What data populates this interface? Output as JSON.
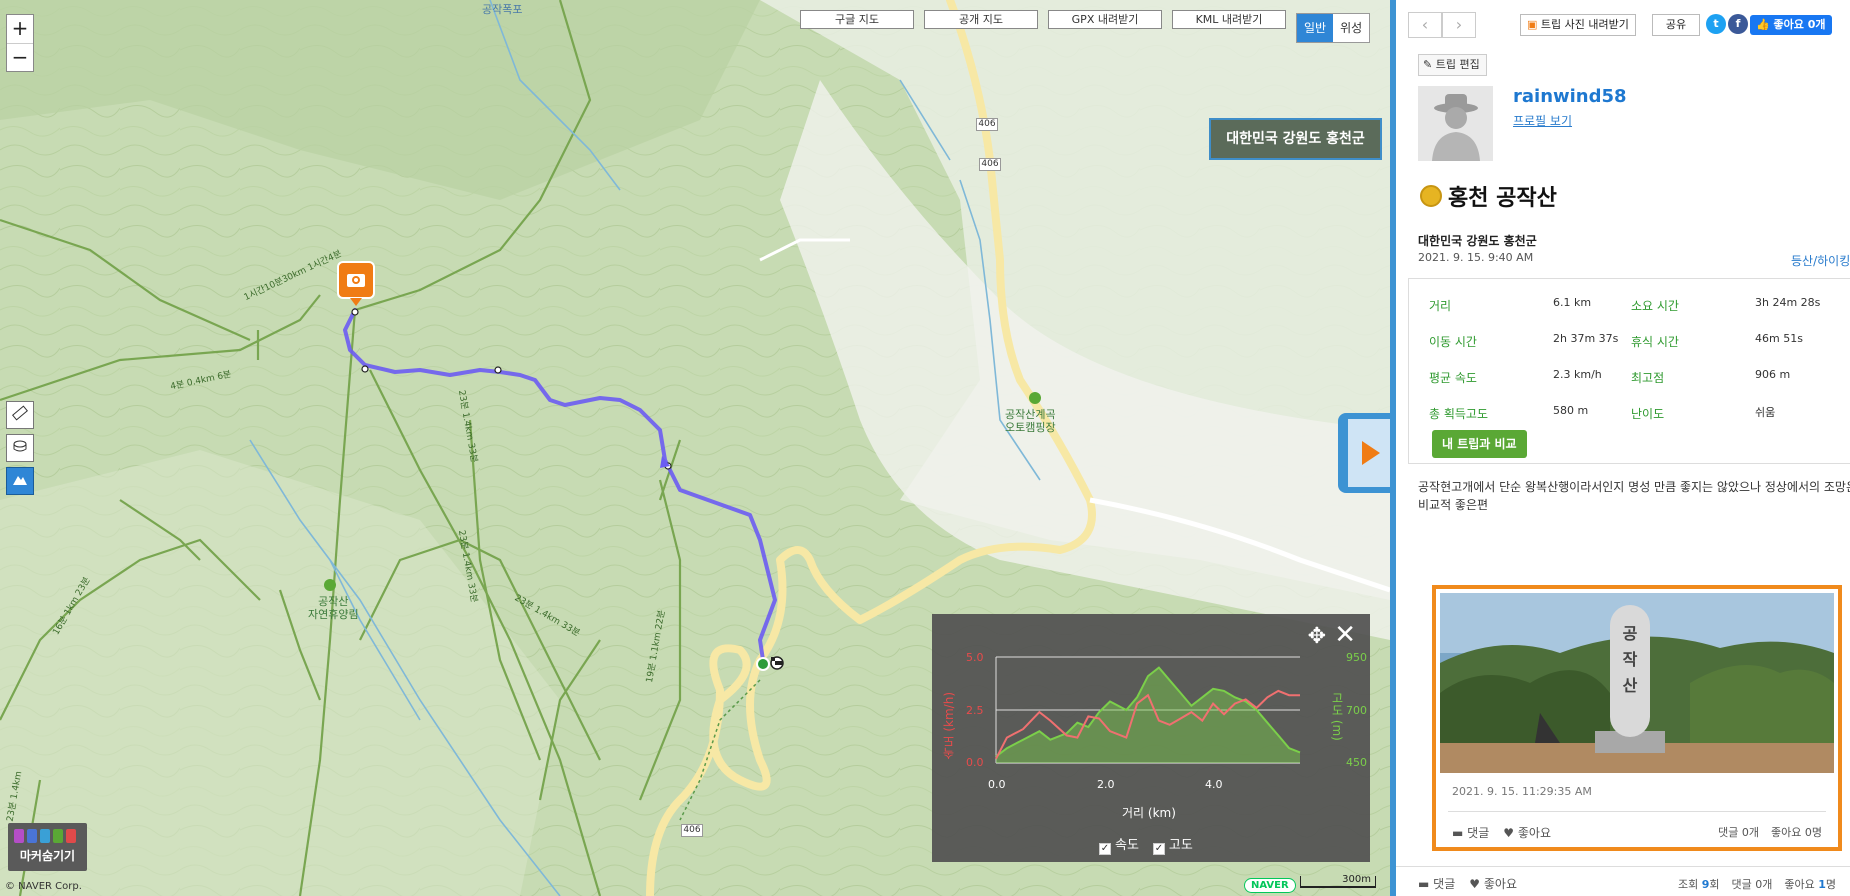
{
  "map": {
    "zoom_in": "+",
    "zoom_out": "−",
    "top_buttons": [
      "구글 지도",
      "공개 지도",
      "GPX 내려받기",
      "KML 내려받기"
    ],
    "map_types": [
      "일반",
      "위성"
    ],
    "region_label": "대한민국 강원도 홍천군",
    "marker_toggle_label": "마커숨기기",
    "copyright": "© NAVER Corp.",
    "naver_logo": "NAVER",
    "scale_label": "300m",
    "poi_labels": {
      "waterfall": "공작폭포",
      "campground": "공작산계곡\n오토캠핑장",
      "forest": "공작산\n자연휴양림"
    },
    "road_number": "406",
    "trail_labels": [
      "1시간10분30km 1시간4분",
      "4분 0.4km 6분",
      "23분 1.4km 33분",
      "23분 1.4km 33분",
      "23분 1.4km 33분",
      "19분 1.1km 22분",
      "16분 1km 23분",
      "23분 1.4km"
    ]
  },
  "elevation_panel": {
    "left_axis_title": "속도 (km/h)",
    "right_axis_title": "고도 (m)",
    "left_ticks": [
      "5.0",
      "2.5",
      "0.0"
    ],
    "right_ticks": [
      "950",
      "700",
      "450"
    ],
    "x_ticks": [
      "0.0",
      "2.0",
      "4.0"
    ],
    "x_label": "거리 (km)",
    "legend": [
      "속도",
      "고도"
    ],
    "colors": {
      "speed": "#f07070",
      "altitude": "#7bcf4a"
    }
  },
  "chart_data": {
    "type": "line",
    "xlabel": "거리 (km)",
    "xlim": [
      0,
      5.6
    ],
    "series": [
      {
        "name": "속도",
        "axis": "left",
        "ylim": [
          0,
          5
        ],
        "x": [
          0,
          0.2,
          0.5,
          0.8,
          1.0,
          1.3,
          1.5,
          1.7,
          1.9,
          2.1,
          2.4,
          2.6,
          2.8,
          3.0,
          3.2,
          3.4,
          3.6,
          3.8,
          4.0,
          4.2,
          4.4,
          4.6,
          4.8,
          5.0,
          5.2,
          5.4,
          5.6
        ],
        "values": [
          0.2,
          1.2,
          1.6,
          2.4,
          2.0,
          1.3,
          1.2,
          2.2,
          2.1,
          1.5,
          1.2,
          2.8,
          3.2,
          2.0,
          1.8,
          2.1,
          2.4,
          2.0,
          2.8,
          2.3,
          2.8,
          3.0,
          2.6,
          3.1,
          3.4,
          3.2,
          3.2
        ]
      },
      {
        "name": "고도",
        "axis": "right",
        "ylim": [
          450,
          950
        ],
        "x": [
          0,
          0.2,
          0.5,
          0.8,
          1.0,
          1.3,
          1.5,
          1.7,
          1.9,
          2.1,
          2.4,
          2.6,
          2.8,
          3.0,
          3.2,
          3.4,
          3.6,
          3.8,
          4.0,
          4.2,
          4.4,
          4.6,
          4.8,
          5.0,
          5.2,
          5.4,
          5.6
        ],
        "values": [
          480,
          520,
          560,
          600,
          560,
          590,
          640,
          620,
          690,
          740,
          700,
          760,
          860,
          900,
          840,
          780,
          720,
          760,
          800,
          790,
          760,
          740,
          700,
          640,
          580,
          520,
          500
        ]
      }
    ]
  },
  "sidebar": {
    "nav_prev": "‹",
    "nav_next": "›",
    "download_photos": "트립 사진 내려받기",
    "share": "공유",
    "twitter": "t",
    "facebook": "f",
    "like_button": "좋아요 0개",
    "edit_trip": "트립 편집",
    "username": "rainwind58",
    "profile_link": "프로필 보기",
    "trip_title": "홍천 공작산",
    "location": "대한민국 강원도 홍천군",
    "date": "2021. 9. 15. 9:40 AM",
    "activity": "등산/하이킹",
    "stats": [
      {
        "k": "거리",
        "v": "6.1 km"
      },
      {
        "k": "소요 시간",
        "v": "3h 24m 28s"
      },
      {
        "k": "이동 시간",
        "v": "2h 37m 37s"
      },
      {
        "k": "휴식 시간",
        "v": "46m 51s"
      },
      {
        "k": "평균 속도",
        "v": "2.3 km/h"
      },
      {
        "k": "최고점",
        "v": "906 m"
      },
      {
        "k": "총 획득고도",
        "v": "580 m"
      },
      {
        "k": "난이도",
        "v": "쉬움"
      }
    ],
    "compare_button": "내 트립과 비교",
    "description": "공작현고개에서 단순 왕복산행이라서인지 명성 만큼 좋지는 않았으나 정상에서의 조망은 비교적 좋은편",
    "photo": {
      "stone_text": "공작산",
      "date": "2021. 9. 15. 11:29:35 AM",
      "comment": "댓글",
      "like": "좋아요",
      "comment_count": "댓글 0개",
      "like_count": "좋아요 0명"
    },
    "bottom": {
      "comment": "댓글",
      "like": "좋아요",
      "views_prefix": "조회",
      "views": "9",
      "views_suffix": "회",
      "comments": "댓글 0개",
      "likes_prefix": "좋아요",
      "likes": "1",
      "likes_suffix": "명"
    }
  }
}
